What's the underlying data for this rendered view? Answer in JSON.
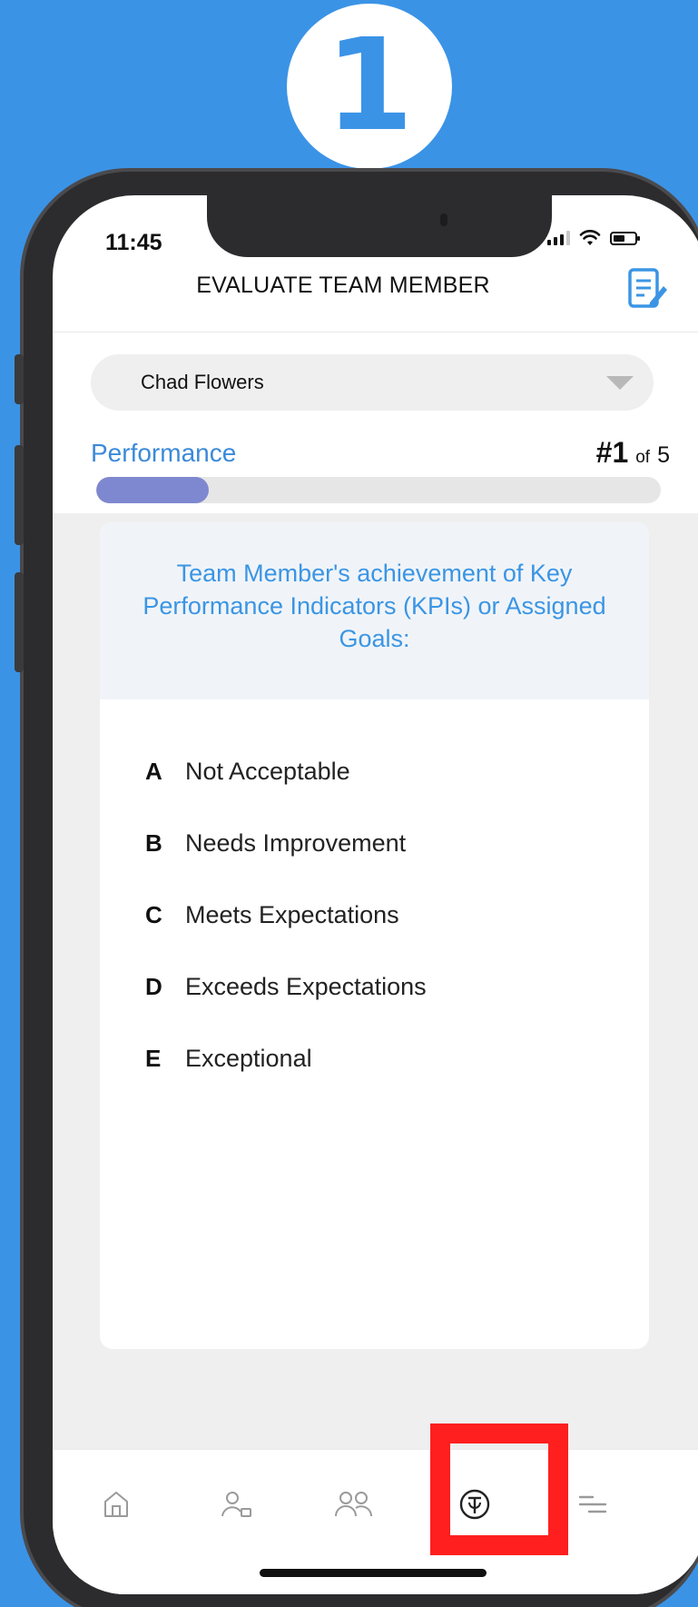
{
  "step_badge": {
    "number": "1"
  },
  "status_bar": {
    "time": "11:45"
  },
  "header": {
    "title": "EVALUATE TEAM MEMBER"
  },
  "member_select": {
    "selected": "Chad Flowers"
  },
  "section": {
    "label": "Performance",
    "current": "#1",
    "of_label": "of",
    "total": "5",
    "progress_fraction": 0.2
  },
  "question": {
    "text": "Team Member's achievement of Key Performance Indicators (KPIs) or Assigned Goals:"
  },
  "options": [
    {
      "letter": "A",
      "label": "Not Acceptable"
    },
    {
      "letter": "B",
      "label": "Needs Improvement"
    },
    {
      "letter": "C",
      "label": "Meets Expectations"
    },
    {
      "letter": "D",
      "label": "Exceeds Expectations"
    },
    {
      "letter": "E",
      "label": "Exceptional"
    }
  ],
  "bottom_nav": {
    "items": [
      {
        "icon": "home-icon"
      },
      {
        "icon": "team-member-icon"
      },
      {
        "icon": "team-icon"
      },
      {
        "icon": "evaluate-icon",
        "highlighted": true
      },
      {
        "icon": "menu-icon"
      }
    ]
  },
  "colors": {
    "background": "#3b93e6",
    "accent": "#3b95e4",
    "progress": "#7e88d0",
    "highlight": "#ff1f1f"
  }
}
